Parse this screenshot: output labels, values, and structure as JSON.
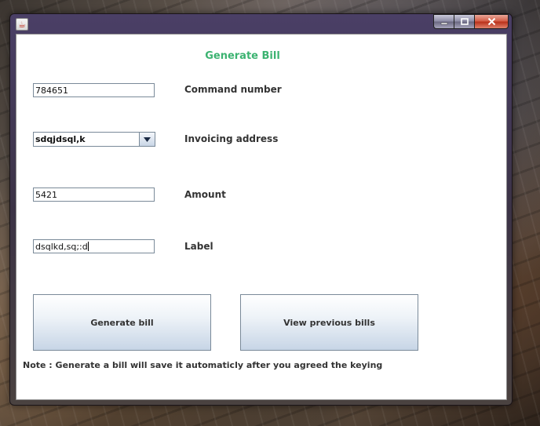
{
  "window": {
    "app_icon": "java-icon",
    "controls": {
      "minimize": "minimize-icon",
      "maximize": "maximize-icon",
      "close": "close-icon"
    }
  },
  "form": {
    "title": "Generate Bill",
    "title_color": "#3cb371",
    "command_number": {
      "label": "Command number",
      "value": "784651"
    },
    "invoicing_address": {
      "label": "Invoicing address",
      "value": "sdqjdsql,k"
    },
    "amount": {
      "label": "Amount",
      "value": "5421"
    },
    "bill_label": {
      "label": "Label",
      "value": "dsqlkd,sq;:d"
    },
    "buttons": {
      "generate": "Generate bill",
      "view_previous": "View previous bills"
    },
    "note": "Note : Generate a bill will save it automaticly after you agreed the keying"
  }
}
